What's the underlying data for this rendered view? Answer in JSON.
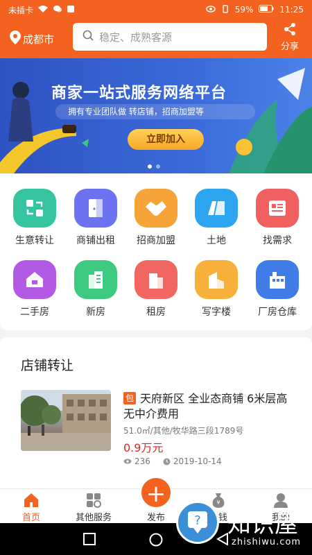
{
  "status_bar": {
    "carrier": "未插卡",
    "battery": "59%",
    "time": "11:25"
  },
  "header": {
    "city": "成都市",
    "search_placeholder": "稳定、成熟客源",
    "share_label": "分享"
  },
  "banner": {
    "title": "商家一站式服务网络平台",
    "subtitle": "拥有专业团队做 转店铺，招商加盟等",
    "cta": "立即加入",
    "active_slide": 1,
    "slide_count": 2
  },
  "categories": [
    {
      "label": "生意转让",
      "color": "#35c4a0",
      "icon": "transfer-icon"
    },
    {
      "label": "商铺出租",
      "color": "#6d73f0",
      "icon": "door-icon"
    },
    {
      "label": "招商加盟",
      "color": "#f6a43a",
      "icon": "handshake-icon"
    },
    {
      "label": "土地",
      "color": "#2da5f0",
      "icon": "land-icon"
    },
    {
      "label": "找需求",
      "color": "#f06060",
      "icon": "demand-icon"
    },
    {
      "label": "二手房",
      "color": "#b25ae6",
      "icon": "house-icon"
    },
    {
      "label": "新房",
      "color": "#3ec980",
      "icon": "new-building-icon"
    },
    {
      "label": "租房",
      "color": "#f26661",
      "icon": "rent-building-icon"
    },
    {
      "label": "写字楼",
      "color": "#f7b03a",
      "icon": "office-icon"
    },
    {
      "label": "厂房仓库",
      "color": "#3f7ce8",
      "icon": "factory-icon"
    }
  ],
  "section": {
    "title": "店铺转让",
    "listing": {
      "tag": "包",
      "title": "天府新区 全业态商铺 6米层高 无中介费用",
      "meta": "51.0㎡/其他/牧华路三段1789号",
      "price": "0.9万元",
      "views": "236",
      "date": "2019-10-14"
    }
  },
  "tabbar": {
    "home": "首页",
    "services": "其他服务",
    "publish": "发布",
    "earn": "挣钱",
    "mine": "我的"
  },
  "watermark": {
    "cn": "知识屋",
    "en": "zhishiwu.com"
  },
  "colors": {
    "brand": "#f4621f",
    "price": "#e02a1c"
  }
}
